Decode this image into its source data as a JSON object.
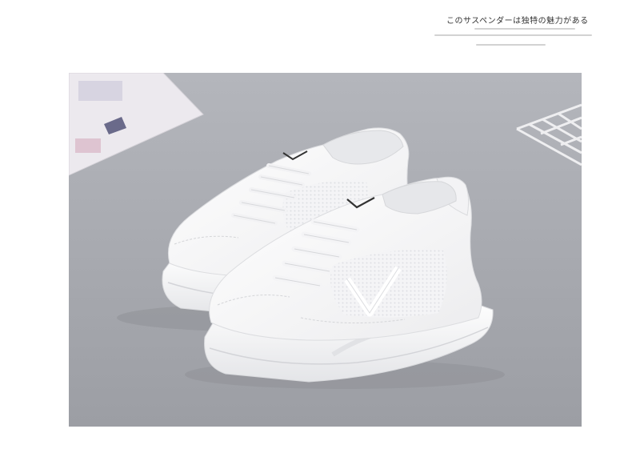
{
  "header": {
    "title": "このサスペンダーは独特の魅力がある"
  },
  "photo": {
    "subject": "pair-of-white-sneakers",
    "colors": {
      "background": "#a9abb1",
      "shoe": "#f8f8f8",
      "shadow": "#8f9197"
    }
  }
}
